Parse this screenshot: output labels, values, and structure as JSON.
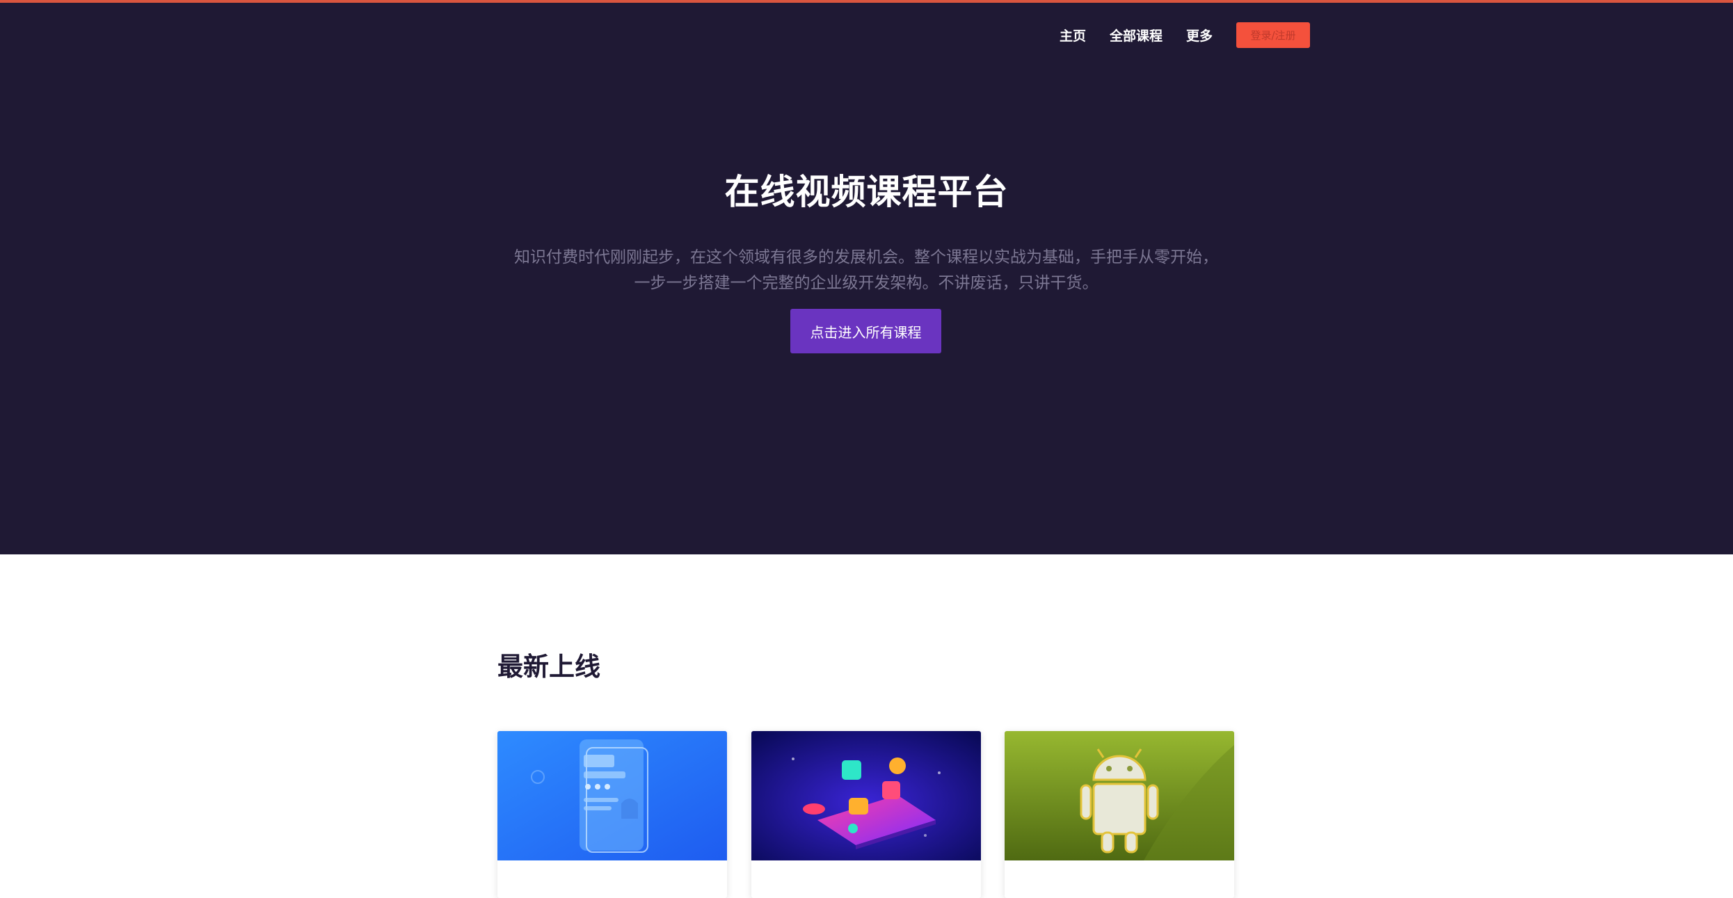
{
  "nav": {
    "home": "主页",
    "all_courses": "全部课程",
    "more": "更多",
    "login": "登录/注册"
  },
  "hero": {
    "title": "在线视频课程平台",
    "desc_line1": "知识付费时代刚刚起步，在这个领域有很多的发展机会。整个课程以实战为基础，手把手从零开始，",
    "desc_line2": "一步一步搭建一个完整的企业级开发架构。不讲废话，只讲干货。",
    "cta": "点击进入所有课程"
  },
  "latest": {
    "title": "最新上线",
    "cards": [
      {
        "thumbnail": "android-phone-blue"
      },
      {
        "thumbnail": "social-phone-isometric"
      },
      {
        "thumbnail": "android-robot-green"
      }
    ]
  },
  "colors": {
    "hero_bg": "#1f1934",
    "accent_top": "#d9553f",
    "login_bg": "#f4513c",
    "cta_bg": "#6a34c0"
  }
}
